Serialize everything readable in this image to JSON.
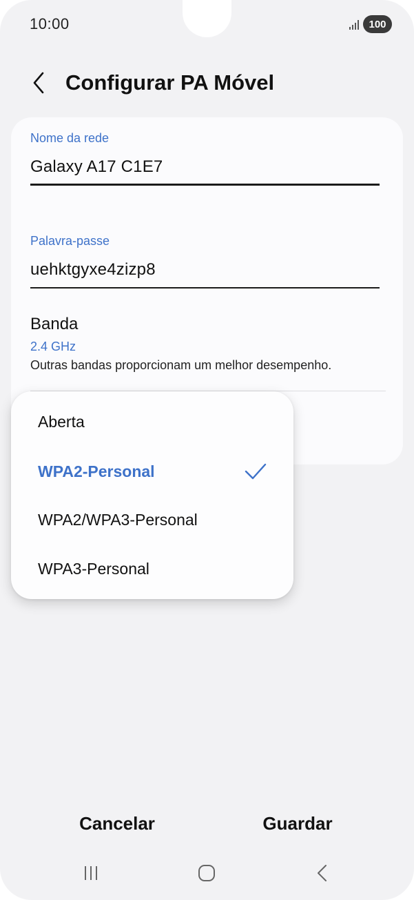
{
  "status_bar": {
    "time": "10:00",
    "battery": "100"
  },
  "header": {
    "title": "Configurar PA Móvel",
    "back_icon": "chevron-left-icon"
  },
  "form": {
    "network_name": {
      "label": "Nome da rede",
      "value": "Galaxy A17 C1E7"
    },
    "password": {
      "label": "Palavra-passe",
      "value": "uehktgyxe4zizp8"
    },
    "band": {
      "title": "Banda",
      "value": "2.4 GHz",
      "description": "Outras bandas proporcionam um melhor desempenho."
    }
  },
  "security_dropdown": {
    "options": [
      {
        "label": "Aberta",
        "selected": false
      },
      {
        "label": "WPA2-Personal",
        "selected": true
      },
      {
        "label": "WPA2/WPA3-Personal",
        "selected": false
      },
      {
        "label": "WPA3-Personal",
        "selected": false
      }
    ],
    "check_icon": "checkmark-icon"
  },
  "actions": {
    "cancel_label": "Cancelar",
    "save_label": "Guardar"
  },
  "navigation_bar": {
    "recents_icon": "recents-icon",
    "home_icon": "home-icon",
    "back_icon": "back-icon"
  },
  "colors": {
    "accent": "#3e72c9",
    "background": "#f2f2f4",
    "card": "#fbfbfd"
  }
}
